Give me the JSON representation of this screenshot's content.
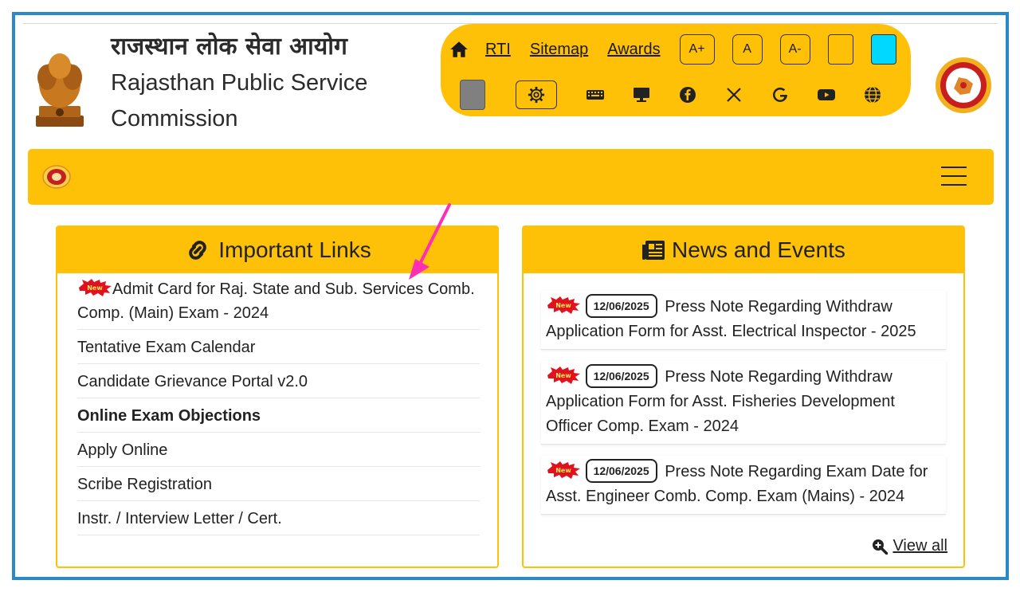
{
  "header": {
    "title_hindi": "राजस्थान लोक सेवा आयोग",
    "title_english": "Rajasthan Public Service Commission"
  },
  "toolbar": {
    "links": [
      "RTI",
      "Sitemap",
      "Awards"
    ],
    "font_buttons": [
      "A+",
      "A",
      "A-"
    ],
    "swatch_colors": [
      "#ffc107",
      "#00d8ff",
      "#808080"
    ],
    "icons": [
      "home-icon",
      "gear-icon",
      "keyboard-icon",
      "desktop-icon",
      "facebook-icon",
      "x-icon",
      "google-icon",
      "youtube-icon",
      "globe-icon"
    ]
  },
  "important_links": {
    "title": "Important Links",
    "items": [
      {
        "label": "Admit Card for Raj. State and Sub. Services Comb. Comp. (Main) Exam - 2024",
        "new": true
      },
      {
        "label": "Tentative Exam Calendar",
        "new": false
      },
      {
        "label": "Candidate Grievance Portal v2.0",
        "new": false
      },
      {
        "label": "Online Exam Objections",
        "new": false
      },
      {
        "label": "Apply Online",
        "new": false
      },
      {
        "label": "Scribe Registration",
        "new": false
      },
      {
        "label": "Instr. / Interview Letter / Cert.",
        "new": false
      }
    ]
  },
  "news": {
    "title": "News and Events",
    "items": [
      {
        "date": "12/06/2025",
        "text": "Press Note Regarding Withdraw Application Form for Asst. Electrical Inspector - 2025"
      },
      {
        "date": "12/06/2025",
        "text": "Press Note Regarding Withdraw Application Form for Asst. Fisheries Development Officer Comp. Exam - 2024"
      },
      {
        "date": "12/06/2025",
        "text": "Press Note Regarding Exam Date for Asst. Engineer Comb. Comp. Exam (Mains) - 2024"
      }
    ],
    "view_all": "View all"
  },
  "colors": {
    "accent": "#ffc107",
    "frame": "#2a8ac7",
    "annotation_arrow": "#ff2fb4"
  }
}
